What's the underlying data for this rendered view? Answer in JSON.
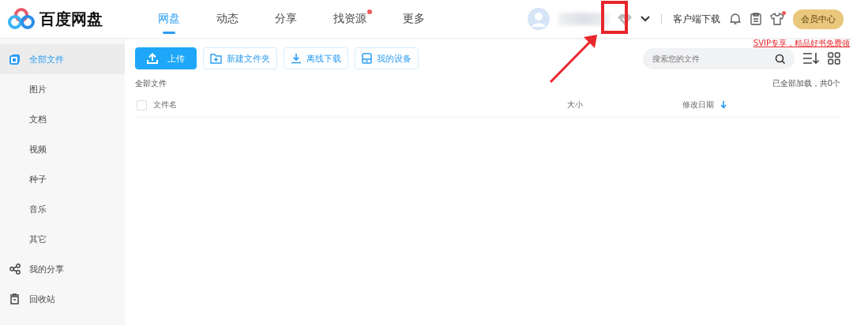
{
  "logo": {
    "text": "百度网盘"
  },
  "nav_tabs": [
    {
      "label": "网盘",
      "selected": true,
      "badge": false
    },
    {
      "label": "动态",
      "selected": false,
      "badge": false
    },
    {
      "label": "分享",
      "selected": false,
      "badge": false
    },
    {
      "label": "找资源",
      "selected": false,
      "badge": true
    },
    {
      "label": "更多",
      "selected": false,
      "badge": false
    }
  ],
  "header_right": {
    "client_download": "客户端下载",
    "skin_badge": true,
    "vip_button": "会员中心"
  },
  "promo_link": "SVIP专享，精品好书免费领",
  "sidebar": {
    "items": [
      {
        "label": "全部文件",
        "kind": "files",
        "selected": true,
        "children": [
          {
            "label": "图片",
            "selected": false
          },
          {
            "label": "文档",
            "selected": false
          },
          {
            "label": "视频",
            "selected": false
          },
          {
            "label": "种子",
            "selected": false
          },
          {
            "label": "音乐",
            "selected": false
          },
          {
            "label": "其它",
            "selected": false
          }
        ]
      },
      {
        "label": "我的分享",
        "kind": "share",
        "selected": false
      },
      {
        "label": "回收站",
        "kind": "trash",
        "selected": false
      }
    ]
  },
  "toolbar": {
    "buttons": [
      {
        "label": "上传",
        "kind": "upload"
      },
      {
        "label": "新建文件夹",
        "kind": "folder"
      },
      {
        "label": "离线下载",
        "kind": "download"
      },
      {
        "label": "我的设备",
        "kind": "device"
      }
    ]
  },
  "search": {
    "placeholder": "搜索您的文件"
  },
  "breadcrumb": "全部文件",
  "load_status": "已全部加载，共0个",
  "table": {
    "select_all_checked": false,
    "columns": [
      {
        "label": "文件名",
        "kind": "name",
        "sorted": false
      },
      {
        "label": "大小",
        "kind": "size",
        "sorted": false
      },
      {
        "label": "修改日期",
        "kind": "date",
        "sorted": true
      }
    ]
  }
}
